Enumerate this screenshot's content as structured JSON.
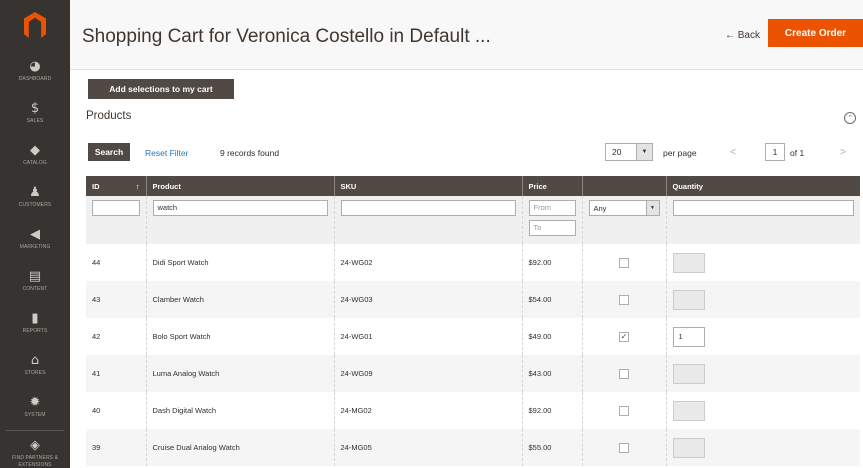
{
  "sidebar": {
    "items": [
      {
        "label": "DASHBOARD",
        "icon": "dashboard-icon",
        "glyph": "◕"
      },
      {
        "label": "SALES",
        "icon": "dollar-icon",
        "glyph": "$"
      },
      {
        "label": "CATALOG",
        "icon": "catalog-cube-icon",
        "glyph": "◆"
      },
      {
        "label": "CUSTOMERS",
        "icon": "customer-icon",
        "glyph": "♟"
      },
      {
        "label": "MARKETING",
        "icon": "megaphone-icon",
        "glyph": "◀"
      },
      {
        "label": "CONTENT",
        "icon": "content-page-icon",
        "glyph": "▤"
      },
      {
        "label": "REPORTS",
        "icon": "bar-chart-icon",
        "glyph": "▮"
      },
      {
        "label": "STORES",
        "icon": "store-icon",
        "glyph": "⌂"
      },
      {
        "label": "SYSTEM",
        "icon": "gear-icon",
        "glyph": "✹"
      },
      {
        "label": "FIND PARTNERS & EXTENSIONS",
        "icon": "partners-cube-icon",
        "glyph": "◈"
      }
    ]
  },
  "header": {
    "title": "Shopping Cart for Veronica Costello in Default ...",
    "back_label": "← Back",
    "create_order_label": "Create Order"
  },
  "toolbar": {
    "add_selections_label": "Add selections to my cart",
    "section_title": "Products",
    "collapse_glyph": "⌃",
    "search_label": "Search",
    "reset_filter_label": "Reset Filter",
    "records_found": "9 records found",
    "per_page_value": "20",
    "per_page_arrow": "▼",
    "per_page_label": "per page",
    "pager_prev": "<",
    "page_current": "1",
    "page_of": "of 1",
    "pager_next": ">"
  },
  "grid": {
    "columns": {
      "id": "ID",
      "sort": "↑",
      "product": "Product",
      "sku": "SKU",
      "price": "Price",
      "select": "",
      "quantity": "Quantity"
    },
    "filters": {
      "id": "",
      "product": "watch",
      "sku": "",
      "price_from": "From",
      "price_to": "To",
      "select": "Any",
      "select_arrow": "▼",
      "quantity": ""
    },
    "rows": [
      {
        "id": "44",
        "product": "Didi Sport Watch",
        "sku": "24-WG02",
        "price": "$92.00",
        "check": "",
        "qty": ""
      },
      {
        "id": "43",
        "product": "Clamber Watch",
        "sku": "24-WG03",
        "price": "$54.00",
        "check": "",
        "qty": ""
      },
      {
        "id": "42",
        "product": "Bolo Sport Watch",
        "sku": "24-WG01",
        "price": "$49.00",
        "check": "✓",
        "qty": "1"
      },
      {
        "id": "41",
        "product": "Luma Analog Watch",
        "sku": "24-WG09",
        "price": "$43.00",
        "check": "",
        "qty": ""
      },
      {
        "id": "40",
        "product": "Dash Digital Watch",
        "sku": "24-MG02",
        "price": "$92.00",
        "check": "",
        "qty": ""
      },
      {
        "id": "39",
        "product": "Cruise Dual Analog Watch",
        "sku": "24-MG05",
        "price": "$55.00",
        "check": "",
        "qty": ""
      }
    ]
  },
  "colors": {
    "accent": "#eb5202",
    "sidebar_bg": "#373330",
    "header_row_bg": "#514943",
    "link": "#1979c3"
  }
}
